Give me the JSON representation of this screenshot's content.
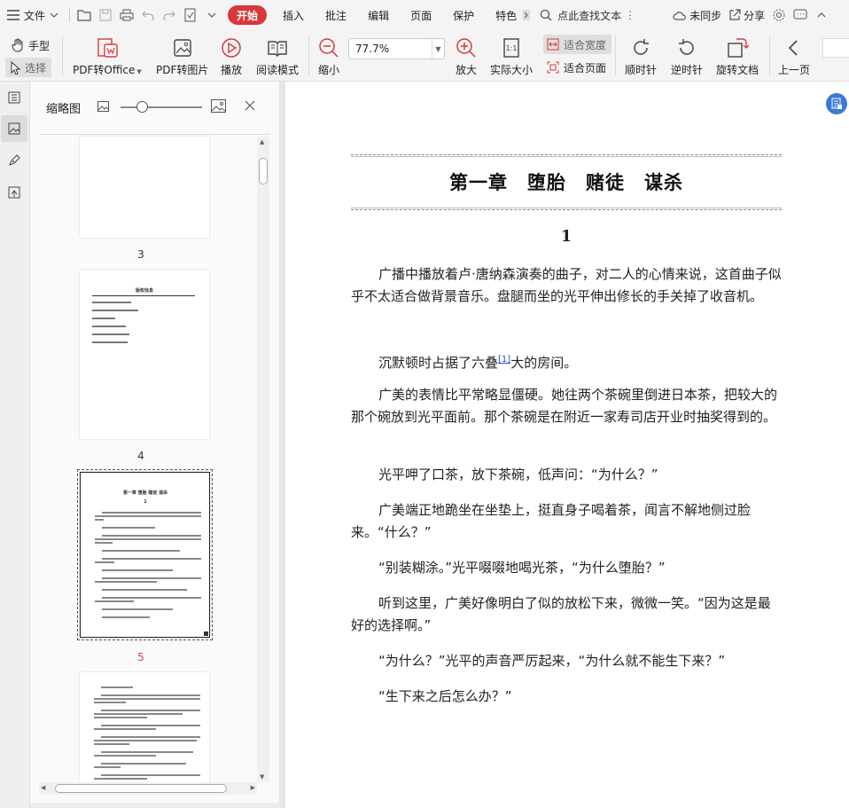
{
  "menu": {
    "file": "文件",
    "tabs": [
      "开始",
      "插入",
      "批注",
      "编辑",
      "页面",
      "保护",
      "特色"
    ],
    "search": "点此查找文本",
    "sync": "未同步",
    "share": "分享"
  },
  "toolbar": {
    "hand": "手型",
    "select": "选择",
    "pdf_office": "PDF转Office",
    "pdf_image": "PDF转图片",
    "play": "播放",
    "read_mode": "阅读模式",
    "zoom_out": "缩小",
    "zoom_value": "77.7%",
    "zoom_in": "放大",
    "actual_size": "实际大小",
    "fit_width": "适合宽度",
    "fit_page": "适合页面",
    "rotate_cw": "顺时针",
    "rotate_ccw": "逆时针",
    "rotate_doc": "旋转文档",
    "prev_page": "上一页"
  },
  "thumbnails": {
    "title": "缩略图",
    "pages": [
      {
        "num": "3"
      },
      {
        "num": "4",
        "heading": "版权信息"
      },
      {
        "num": "5",
        "heading": "第一章 堕胎 赌徒 谋杀",
        "section": "1"
      }
    ]
  },
  "document": {
    "chapter_title": "第一章　堕胎　赌徒　谋杀",
    "section": "1",
    "p1": "广播中播放着卢·唐纳森演奏的曲子，对二人的心情来说，这首曲子似乎不太适合做背景音乐。盘腿而坐的光平伸出修长的手关掉了收音机。",
    "p2a": "沉默顿时占据了六叠",
    "p2fn": "[1]",
    "p2b": "大的房间。",
    "p3": "广美的表情比平常略显僵硬。她往两个茶碗里倒进日本茶，把较大的那个碗放到光平面前。那个茶碗是在附近一家寿司店开业时抽奖得到的。",
    "p4": "光平呷了口茶，放下茶碗，低声问：“为什么？”",
    "p5": "广美端正地跪坐在坐垫上，挺直身子喝着茶，闻言不解地侧过脸来。“什么？”",
    "p6": "“别装糊涂。”光平啜啜地喝光茶，“为什么堕胎？”",
    "p7": "听到这里，广美好像明白了似的放松下来，微微一笑。“因为这是最好的选择啊。”",
    "p8": "“为什么？”光平的声音严厉起来，“为什么就不能生下来？”",
    "p9": "“生下来之后怎么办？”"
  }
}
